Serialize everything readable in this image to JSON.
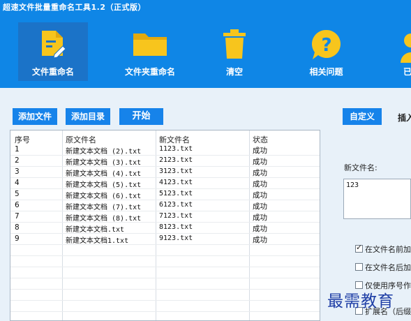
{
  "app": {
    "title": "超速文件批量重命名工具1.2（正式版）"
  },
  "nav": [
    {
      "label": "文件重命名",
      "icon": "file-edit-icon",
      "active": true
    },
    {
      "label": "文件夹重命名",
      "icon": "folder-icon",
      "active": false
    },
    {
      "label": "清空",
      "icon": "trash-icon",
      "active": false
    },
    {
      "label": "相关问题",
      "icon": "help-bubble-icon",
      "active": false
    },
    {
      "label": "已",
      "icon": "user-icon",
      "active": false
    }
  ],
  "toolbar": {
    "add_file": "添加文件",
    "add_dir": "添加目录",
    "start": "开始"
  },
  "table": {
    "headers": [
      "序号",
      "原文件名",
      "新文件名",
      "状态"
    ],
    "rows": [
      [
        "1",
        "新建文本文档 (2).txt",
        "1123.txt",
        "成功"
      ],
      [
        "2",
        "新建文本文档 (3).txt",
        "2123.txt",
        "成功"
      ],
      [
        "3",
        "新建文本文档 (4).txt",
        "3123.txt",
        "成功"
      ],
      [
        "4",
        "新建文本文档 (5).txt",
        "4123.txt",
        "成功"
      ],
      [
        "5",
        "新建文本文档 (6).txt",
        "5123.txt",
        "成功"
      ],
      [
        "6",
        "新建文本文档 (7).txt",
        "6123.txt",
        "成功"
      ],
      [
        "7",
        "新建文本文档 (8).txt",
        "7123.txt",
        "成功"
      ],
      [
        "8",
        "新建文本文档.txt",
        "8123.txt",
        "成功"
      ],
      [
        "9",
        "新建文本文档1.txt",
        "9123.txt",
        "成功"
      ]
    ]
  },
  "right": {
    "tab_custom": "自定义",
    "tab_insert": "插入",
    "new_name_label": "新文件名:",
    "new_name_value": "123",
    "opt_before": "在文件名前加",
    "opt_after": "在文件名后加",
    "opt_seq_only": "仅使用序号作",
    "opt_ext": "扩展名（后缀"
  },
  "watermark": "最需教育",
  "colors": {
    "banner": "#0f86e6",
    "button": "#1683ea",
    "panel": "#e8f1f9"
  }
}
